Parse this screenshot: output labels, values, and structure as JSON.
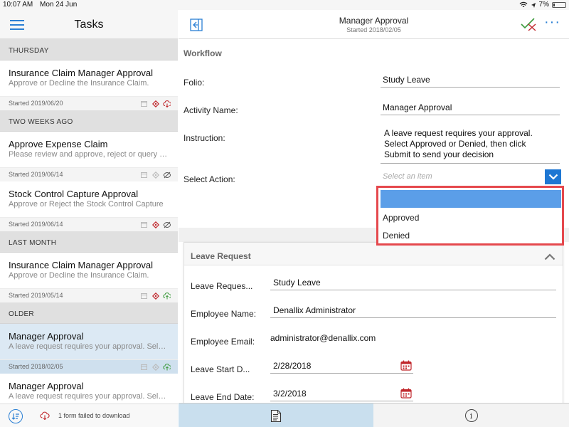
{
  "status_bar": {
    "time": "10:07 AM",
    "date": "Mon 24 Jun",
    "battery": "7%"
  },
  "sidebar": {
    "title": "Tasks",
    "groups": [
      {
        "label": "THURSDAY",
        "tasks": [
          {
            "title": "Insurance Claim Manager Approval",
            "desc": "Approve or Decline the Insurance Claim.",
            "date": "Started 2019/06/20",
            "status_icon": "cloud-download-icon"
          }
        ]
      },
      {
        "label": "TWO WEEKS AGO",
        "tasks": [
          {
            "title": "Approve Expense Claim",
            "desc": "Please review and approve, reject or query the expense claim",
            "date": "Started 2019/06/14",
            "status_icon": "no-view-icon"
          },
          {
            "title": "Stock Control Capture Approval",
            "desc": "Approve or Reject the Stock Control Capture",
            "date": "Started 2019/06/14",
            "status_icon": "no-view-icon"
          }
        ]
      },
      {
        "label": "LAST MONTH",
        "tasks": [
          {
            "title": "Insurance Claim Manager Approval",
            "desc": "Approve or Decline the Insurance Claim.",
            "date": "Started 2019/05/14",
            "status_icon": "cloud-upload-icon"
          }
        ]
      },
      {
        "label": "OLDER",
        "tasks": [
          {
            "title": "Manager Approval",
            "desc": "A leave request requires your approval. Select Approved or Denied",
            "date": "Started 2018/02/05",
            "status_icon": "cloud-upload-icon"
          },
          {
            "title": "Manager Approval",
            "desc": "A leave request requires your approval. Select Approved or Denied",
            "date": "",
            "status_icon": ""
          }
        ]
      }
    ],
    "footer_text": "1 form failed to download"
  },
  "header": {
    "title": "Manager Approval",
    "subtitle": "Started 2018/02/05"
  },
  "workflow": {
    "section_title": "Workflow",
    "folio_label": "Folio:",
    "folio_value": "Study Leave",
    "activity_label": "Activity Name:",
    "activity_value": "Manager Approval",
    "instruction_label": "Instruction:",
    "instruction_lines": [
      "A leave request requires your approval.",
      "Select Approved or Denied, then click",
      "Submit to send your decision"
    ],
    "action_label": "Select Action:",
    "action_placeholder": "Select an item",
    "options": [
      "Approved",
      "Denied"
    ]
  },
  "leave_request": {
    "title": "Leave Request",
    "type_label": "Leave Reques...",
    "type_value": "Study Leave",
    "name_label": "Employee Name:",
    "name_value": "Denallix Administrator",
    "email_label": "Employee Email:",
    "email_value": "administrator@denallix.com",
    "start_label": "Leave Start D...",
    "start_value": "2/28/2018",
    "end_label": "Leave End Date:",
    "end_value": "3/2/2018"
  },
  "colors": {
    "accent": "#1e77d3",
    "highlight": "#e5484d",
    "selected_row": "#dce9f4",
    "diamond": "#c0262b"
  }
}
